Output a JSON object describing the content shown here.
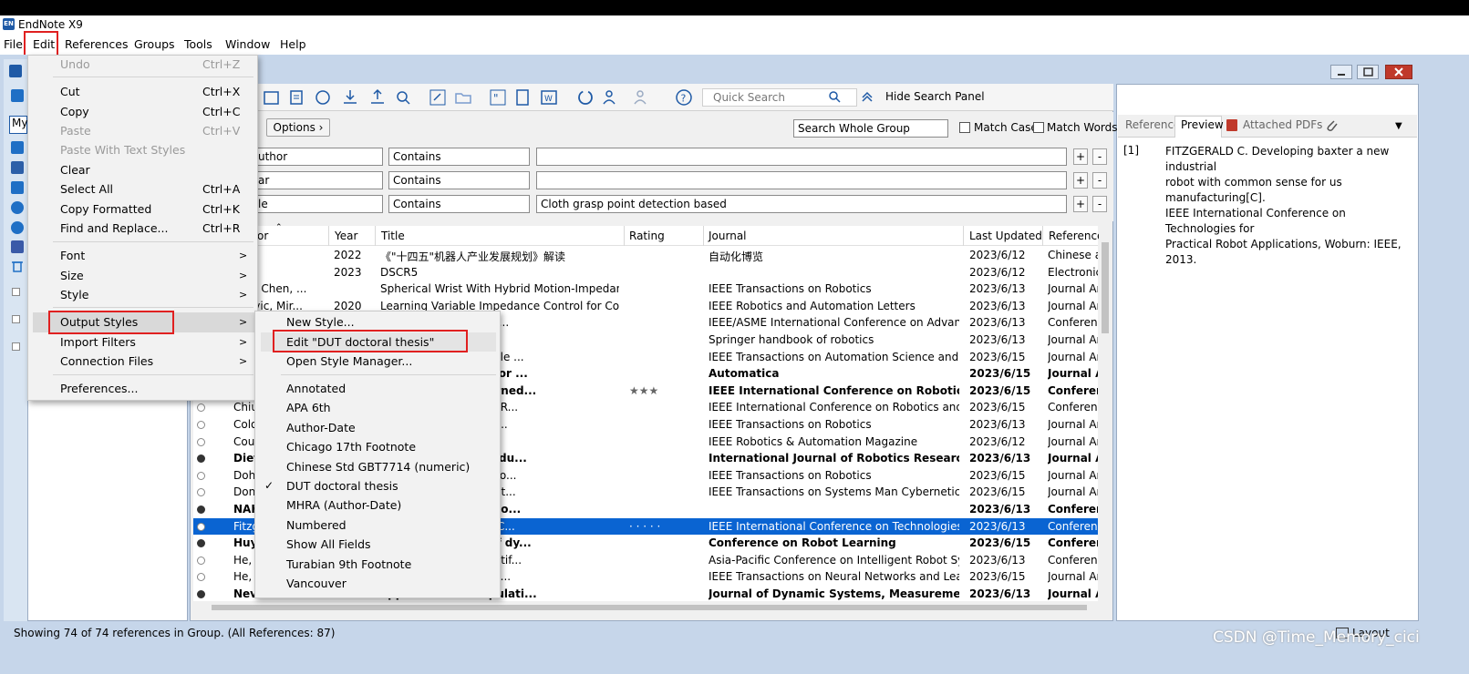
{
  "app": {
    "title": "EndNote X9",
    "logo": "EN"
  },
  "menubar": [
    "File",
    "Edit",
    "References",
    "Groups",
    "Tools",
    "Window",
    "Help"
  ],
  "toolbar": {
    "quick_search_placeholder": "Quick Search",
    "hide_search_panel": "Hide Search Panel"
  },
  "search": {
    "options_label": "Options",
    "scope": "Search Whole Group",
    "match_case": "Match Case",
    "match_words": "Match Words",
    "rows": [
      {
        "field": "Author",
        "field_visible": "uthor",
        "operator": "Contains",
        "value": ""
      },
      {
        "field": "Year",
        "field_visible": "ar",
        "operator": "Contains",
        "value": ""
      },
      {
        "field": "Title",
        "field_visible": "le",
        "operator": "Contains",
        "value": "Cloth grasp point detection based"
      }
    ]
  },
  "table": {
    "headers": {
      "author": "or",
      "year": "Year",
      "title": "Title",
      "rating": "Rating",
      "journal": "Journal",
      "updated": "Last Updated",
      "type": "Reference"
    },
    "rows": [
      {
        "dot": "none",
        "bold": false,
        "author": "",
        "year": "2022",
        "title": "《\"十四五\"机器人产业发展规划》解读",
        "rating": "",
        "journal": "自动化博览",
        "updated": "2023/6/12",
        "type": "Chinese ar"
      },
      {
        "dot": "none",
        "bold": false,
        "author": "",
        "year": "2023",
        "title": "DSCR5",
        "rating": "",
        "journal": "",
        "updated": "2023/6/12",
        "type": "Electronic"
      },
      {
        "dot": "none",
        "bold": false,
        "author": "Kun; Chen, ...",
        "year": "",
        "title": "Spherical Wrist With Hybrid Motion-Impedance ...",
        "rating": "",
        "journal": "IEEE Transactions on Robotics",
        "updated": "2023/6/13",
        "type": "Journal Art"
      },
      {
        "dot": "none",
        "bold": false,
        "author": "anovic, Mir...",
        "year": "2020",
        "title": "Learning Variable Impedance Control for Contact...",
        "rating": "",
        "journal": "IEEE Robotics and Automation Letters",
        "updated": "2023/6/13",
        "type": "Journal Art"
      },
      {
        "dot": "none",
        "bold": false,
        "author": "",
        "year": "",
        "title": "tion on impedance co...",
        "rating": "",
        "journal": "IEEE/ASME International Conference on Advanced I...",
        "updated": "2023/6/13",
        "type": "Conferenc"
      },
      {
        "dot": "none",
        "bold": false,
        "author": "",
        "year": "",
        "title": "n",
        "rating": "",
        "journal": "Springer handbook of robotics",
        "updated": "2023/6/13",
        "type": "Journal Art"
      },
      {
        "dot": "none",
        "bold": false,
        "author": "",
        "year": "",
        "title": "tructures With Unstable ...",
        "rating": "",
        "journal": "IEEE Transactions on Automation Science and Engin...",
        "updated": "2023/6/15",
        "type": "Journal Art"
      },
      {
        "dot": "none",
        "bold": true,
        "author": "",
        "year": "",
        "title": "k tracking control for ...",
        "rating": "",
        "journal": "Automatica",
        "updated": "2023/6/15",
        "type": "Journal Ar"
      },
      {
        "dot": "none",
        "bold": true,
        "author": "",
        "year": "",
        "title": "pulation Using Learned...",
        "rating": "★★★",
        "journal": "IEEE International Conference on Robotics and A...",
        "updated": "2023/6/15",
        "type": "Conferenc"
      },
      {
        "dot": "empty",
        "bold": false,
        "author": "Chiu",
        "year": "",
        "title": "Suture Needles using R...",
        "rating": "",
        "journal": "IEEE International Conference on Robotics and Aut...",
        "updated": "2023/6/15",
        "type": "Conferenc"
      },
      {
        "dot": "empty",
        "bold": false,
        "author": "Colo",
        "year": "",
        "title": "for Dynamic Moveme...",
        "rating": "",
        "journal": "IEEE Transactions on Robotics",
        "updated": "2023/6/13",
        "type": "Journal Art"
      },
      {
        "dot": "empty",
        "bold": false,
        "author": "Cou",
        "year": "",
        "title": "",
        "rating": "",
        "journal": "IEEE Robotics & Automation Magazine",
        "updated": "2023/6/12",
        "type": "Journal Art"
      },
      {
        "dot": "full",
        "bold": true,
        "author": "Diet",
        "year": "",
        "title": "e projections for redu...",
        "rating": "",
        "journal": "International Journal of Robotics Research",
        "updated": "2023/6/13",
        "type": "Journal Ar"
      },
      {
        "dot": "empty",
        "bold": false,
        "author": "Doh",
        "year": "",
        "title": "ooperative Manipulatio...",
        "rating": "",
        "journal": "IEEE Transactions on Robotics",
        "updated": "2023/6/15",
        "type": "Journal Art"
      },
      {
        "dot": "empty",
        "bold": false,
        "author": "Don",
        "year": "",
        "title": "ordinated Robots by St...",
        "rating": "",
        "journal": "IEEE Transactions on Systems Man Cybernetics-Syst...",
        "updated": "2023/6/15",
        "type": "Journal Art"
      },
      {
        "dot": "full",
        "bold": true,
        "author": "NAK",
        "year": "",
        "title": "the anthropomorpho...",
        "rating": "",
        "journal": "",
        "updated": "2023/6/13",
        "type": "Conferenc"
      },
      {
        "dot": "empty",
        "bold": false,
        "selected": true,
        "author": "Fitzg",
        "year": "",
        "title": "Industrial Robot with C...",
        "rating": "· · · · ·",
        "journal": "IEEE International Conference on Technologies for P...",
        "updated": "2023/6/13",
        "type": "Conferenc"
      },
      {
        "dot": "full",
        "bold": true,
        "author": "Huy",
        "year": "",
        "title": "ble effectiveness of dy...",
        "rating": "",
        "journal": "Conference on Robot Learning",
        "updated": "2023/6/15",
        "type": "Conferenc"
      },
      {
        "dot": "empty",
        "bold": false,
        "author": "He, .",
        "year": "",
        "title": "with Variable Object Stif...",
        "rating": "",
        "journal": "Asia-Pacific Conference on Intelligent Robot Syste...",
        "updated": "2023/6/13",
        "type": "Conferenc"
      },
      {
        "dot": "empty",
        "bold": false,
        "author": "He, '",
        "year": "",
        "title": "ed Neural Network Co...",
        "rating": "",
        "journal": "IEEE Transactions on Neural Networks and Learning ...",
        "updated": "2023/6/15",
        "type": "Journal Art"
      },
      {
        "dot": "full",
        "bold": true,
        "author": "Nev",
        "year": "",
        "title": "approach to manipulati...",
        "rating": "",
        "journal": "Journal of Dynamic Systems, Measurement, and ...",
        "updated": "2023/6/13",
        "type": "Journal Ar"
      }
    ]
  },
  "right_panel": {
    "tabs": [
      "Reference",
      "Preview",
      "Attached PDFs"
    ],
    "preview_num": "[1]",
    "preview_lines": [
      "FITZGERALD C. Developing baxter a new industrial",
      "robot with common sense for us manufacturing[C].",
      "IEEE International Conference on Technologies for",
      "Practical Robot Applications, Woburn: IEEE, 2013."
    ]
  },
  "status": {
    "text": "Showing 74 of 74 references in Group. (All References: 87)",
    "layout": "Layout",
    "watermark": "CSDN @Time_Memory_cici",
    "library_label": "My"
  },
  "edit_menu": {
    "undo": "Undo",
    "undo_sc": "Ctrl+Z",
    "cut": "Cut",
    "cut_sc": "Ctrl+X",
    "copy": "Copy",
    "copy_sc": "Ctrl+C",
    "paste": "Paste",
    "paste_sc": "Ctrl+V",
    "paste_with": "Paste With Text Styles",
    "clear": "Clear",
    "select_all": "Select All",
    "select_all_sc": "Ctrl+A",
    "copy_formatted": "Copy Formatted",
    "copy_formatted_sc": "Ctrl+K",
    "find_replace": "Find and Replace...",
    "find_replace_sc": "Ctrl+R",
    "font": "Font",
    "size": "Size",
    "style": "Style",
    "output_styles": "Output Styles",
    "import_filters": "Import Filters",
    "connection_files": "Connection Files",
    "preferences": "Preferences..."
  },
  "output_styles_menu": {
    "new_style": "New Style...",
    "edit_style": "Edit \"DUT doctoral thesis\"",
    "open_manager": "Open Style Manager...",
    "styles": [
      "Annotated",
      "APA 6th",
      "Author-Date",
      "Chicago 17th Footnote",
      "Chinese Std GBT7714 (numeric)",
      "DUT doctoral thesis",
      "MHRA (Author-Date)",
      "Numbered",
      "Show All Fields",
      "Turabian 9th Footnote",
      "Vancouver"
    ],
    "checked": "DUT doctoral thesis"
  },
  "colors": {
    "selection": "#0a64d2",
    "highlight_box": "#e02020",
    "frame": "#c6d6ea"
  }
}
